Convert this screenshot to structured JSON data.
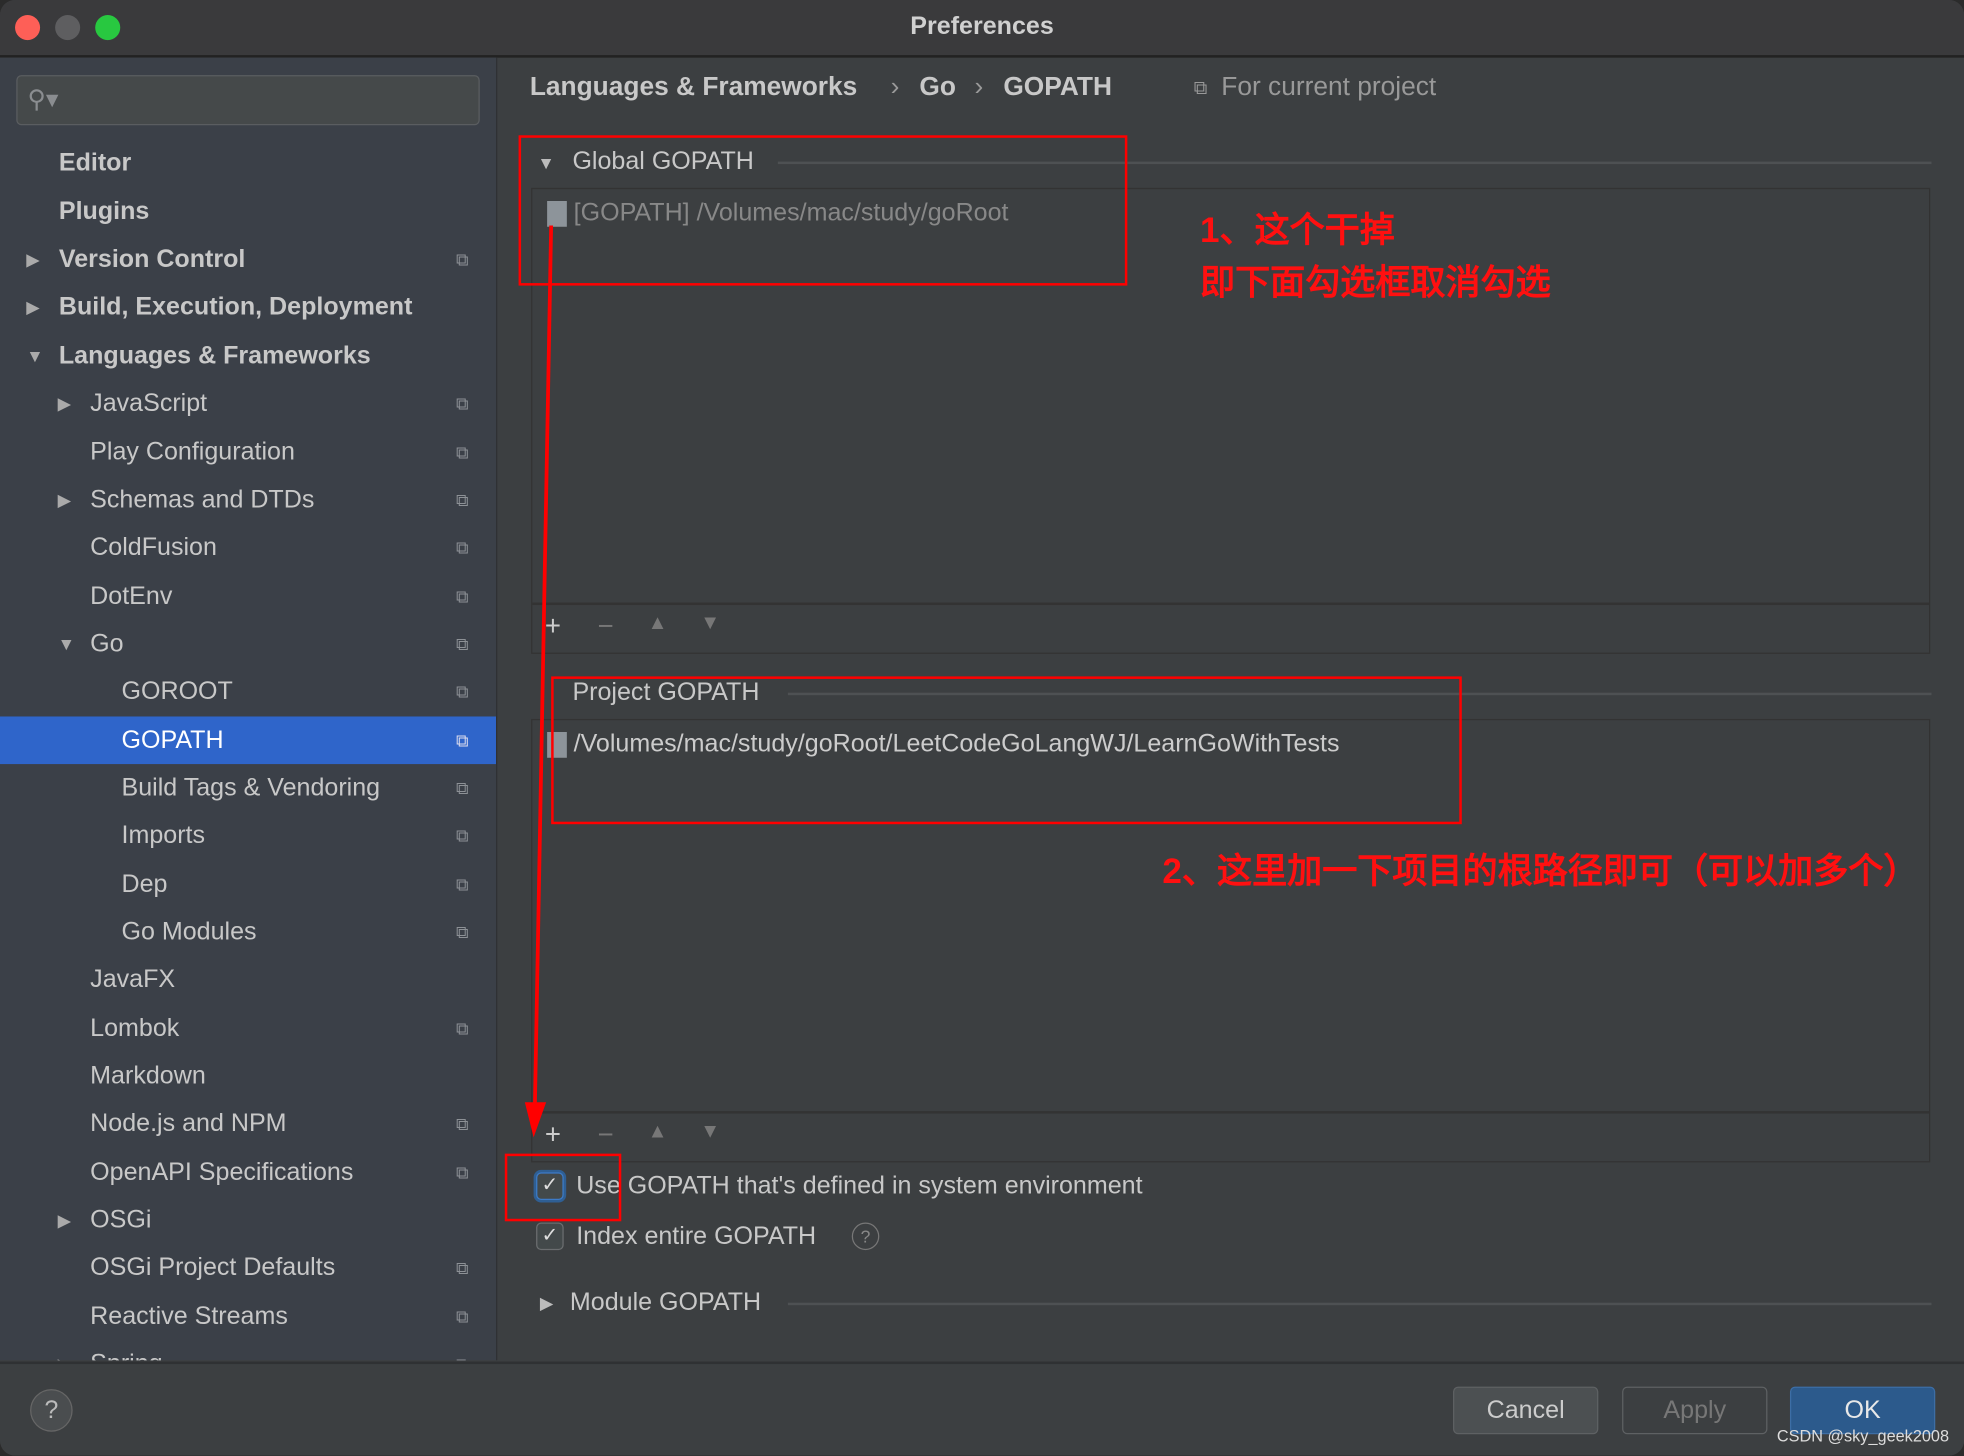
{
  "window": {
    "title": "Preferences"
  },
  "sidebar": {
    "search_placeholder": "",
    "items": [
      {
        "label": "Editor"
      },
      {
        "label": "Plugins"
      },
      {
        "label": "Version Control"
      },
      {
        "label": "Build, Execution, Deployment"
      },
      {
        "label": "Languages & Frameworks"
      },
      {
        "label": "JavaScript"
      },
      {
        "label": "Play Configuration"
      },
      {
        "label": "Schemas and DTDs"
      },
      {
        "label": "ColdFusion"
      },
      {
        "label": "DotEnv"
      },
      {
        "label": "Go"
      },
      {
        "label": "GOROOT"
      },
      {
        "label": "GOPATH"
      },
      {
        "label": "Build Tags & Vendoring"
      },
      {
        "label": "Imports"
      },
      {
        "label": "Dep"
      },
      {
        "label": "Go Modules"
      },
      {
        "label": "JavaFX"
      },
      {
        "label": "Lombok"
      },
      {
        "label": "Markdown"
      },
      {
        "label": "Node.js and NPM"
      },
      {
        "label": "OpenAPI Specifications"
      },
      {
        "label": "OSGi"
      },
      {
        "label": "OSGi Project Defaults"
      },
      {
        "label": "Reactive Streams"
      },
      {
        "label": "Spring"
      }
    ]
  },
  "breadcrumb": {
    "items": [
      "Languages & Frameworks",
      "Go",
      "GOPATH"
    ],
    "scope": "For current project"
  },
  "global_gopath": {
    "title": "Global GOPATH",
    "entries": [
      "[GOPATH] /Volumes/mac/study/goRoot"
    ]
  },
  "project_gopath": {
    "title": "Project GOPATH",
    "entries": [
      "/Volumes/mac/study/goRoot/LeetCodeGoLangWJ/LearnGoWithTests"
    ]
  },
  "options": {
    "use_system_gopath": {
      "label": "Use GOPATH that's defined in system environment",
      "checked": true
    },
    "index_entire": {
      "label": "Index entire GOPATH",
      "checked": true
    }
  },
  "module_gopath": {
    "title": "Module GOPATH"
  },
  "annotations": {
    "note1_line1": "1、这个干掉",
    "note1_line2": "即下面勾选框取消勾选",
    "note2": "2、这里加一下项目的根路径即可（可以加多个）"
  },
  "footer": {
    "help": "?",
    "cancel": "Cancel",
    "apply": "Apply",
    "ok": "OK"
  },
  "watermark": "CSDN @sky_geek2008",
  "colors": {
    "selection": "#2f65ca",
    "annotation": "#ff0000",
    "ok_button": "#2c5a8c"
  }
}
